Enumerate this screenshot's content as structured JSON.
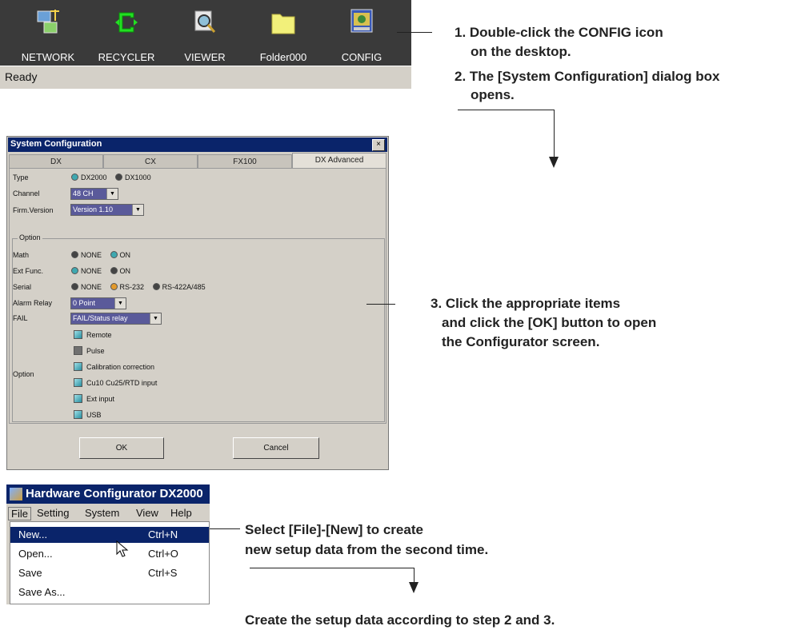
{
  "desktop": {
    "icons": [
      {
        "label": "NETWORK",
        "icon": "network-icon"
      },
      {
        "label": "RECYCLER",
        "icon": "recycler-icon"
      },
      {
        "label": "VIEWER",
        "icon": "viewer-icon"
      },
      {
        "label": "Folder000",
        "icon": "folder-icon"
      },
      {
        "label": "CONFIG",
        "icon": "config-icon"
      }
    ],
    "status": "Ready"
  },
  "callouts": {
    "step1a": "1. Double-click the CONFIG icon",
    "step1b": "on the desktop.",
    "step2a": "2. The [System Configuration] dialog box",
    "step2b": "opens.",
    "step3a": "3. Click the appropriate items",
    "step3b": "and click the [OK] button to open",
    "step3c": "the Configurator screen.",
    "menu_a": "Select [File]-[New] to create",
    "menu_b": "new setup data from the second time.",
    "final": "Create the setup data according to step 2 and 3."
  },
  "dialog": {
    "title": "System Configuration",
    "close": "×",
    "tabs": [
      "DX",
      "CX",
      "FX100",
      "DX Advanced"
    ],
    "type": {
      "label": "Type",
      "options": [
        "DX2000",
        "DX1000"
      ]
    },
    "channel": {
      "label": "Channel",
      "value": "48 CH"
    },
    "firm": {
      "label": "Firm.Version",
      "value": "Version 1.10"
    },
    "option_group": "Option",
    "math": {
      "label": "Math",
      "options": [
        "NONE",
        "ON"
      ]
    },
    "extfunc": {
      "label": "Ext Func.",
      "options": [
        "NONE",
        "ON"
      ]
    },
    "serial": {
      "label": "Serial",
      "options": [
        "NONE",
        "RS-232",
        "RS-422A/485"
      ]
    },
    "alarm": {
      "label": "Alarm Relay",
      "value": "0 Point"
    },
    "fail": {
      "label": "FAIL",
      "value": "FAIL/Status relay"
    },
    "option_label": "Option",
    "checks": [
      {
        "label": "Remote",
        "checked": true
      },
      {
        "label": "Pulse",
        "checked": false
      },
      {
        "label": "Calibration correction",
        "checked": true
      },
      {
        "label": "Cu10 Cu25/RTD input",
        "checked": true
      },
      {
        "label": "Ext input",
        "checked": true
      },
      {
        "label": "USB",
        "checked": true
      }
    ],
    "ok": "OK",
    "cancel": "Cancel",
    "dropdown_glyph": "▼"
  },
  "hw": {
    "title": "Hardware Configurator DX2000",
    "menubar": [
      "File",
      "Setting",
      "System",
      "View",
      "Help"
    ],
    "menu": [
      {
        "name": "New...",
        "key": "Ctrl+N"
      },
      {
        "name": "Open...",
        "key": "Ctrl+O"
      },
      {
        "name": "Save",
        "key": "Ctrl+S"
      },
      {
        "name": "Save As...",
        "key": ""
      }
    ]
  }
}
